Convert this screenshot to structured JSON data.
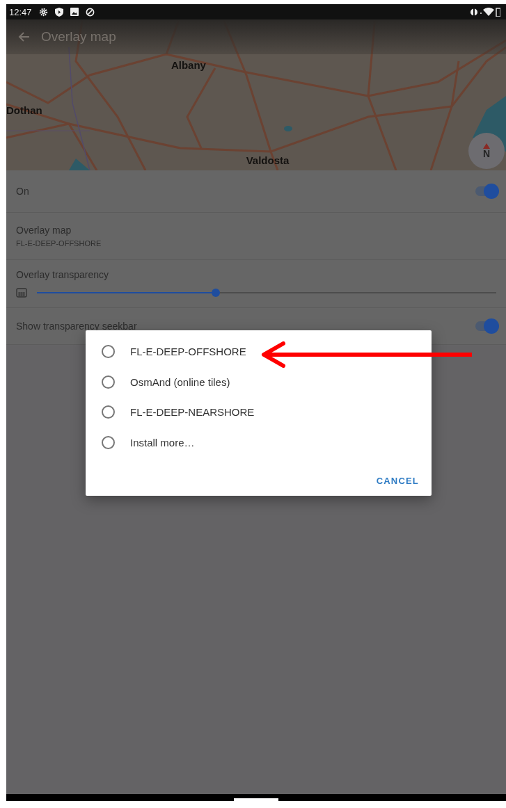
{
  "status_bar": {
    "time": "12:47"
  },
  "app_bar": {
    "title": "Overlay map"
  },
  "map": {
    "labels": [
      {
        "text": "Albany"
      },
      {
        "text": "Dothan"
      },
      {
        "text": "Valdosta"
      }
    ],
    "compass": "N"
  },
  "settings": [
    {
      "kind": "toggle",
      "label": "On",
      "on": true
    },
    {
      "kind": "text",
      "label": "Overlay map",
      "value": "FL-E-DEEP-OFFSHORE"
    },
    {
      "kind": "slider",
      "label": "Overlay transparency",
      "level": 0.39
    },
    {
      "kind": "toggle",
      "label": "Show transparency seekbar",
      "on": true
    }
  ],
  "dialog": {
    "options": [
      {
        "label": "FL-E-DEEP-OFFSHORE",
        "selected": false
      },
      {
        "label": "OsmAnd (online tiles)",
        "selected": false
      },
      {
        "label": "FL-E-DEEP-NEARSHORE",
        "selected": false
      },
      {
        "label": "Install more…",
        "selected": false
      }
    ],
    "cancel": "CANCEL"
  }
}
